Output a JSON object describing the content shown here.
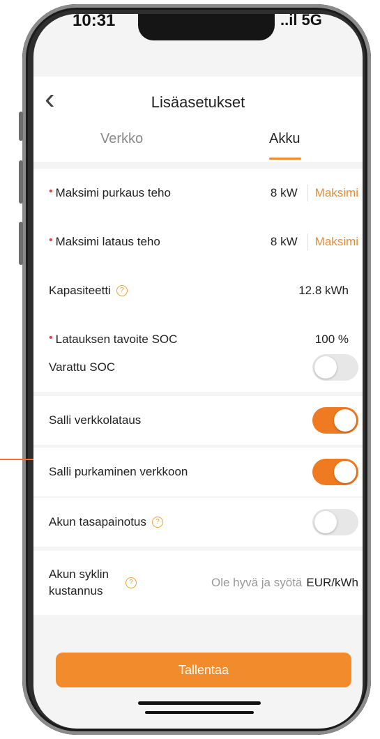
{
  "status_bar": {
    "time": "10:31",
    "right": "..il 5G"
  },
  "nav": {
    "back_icon": "chevron-left-icon",
    "title": "Lisäasetukset"
  },
  "tabs": [
    {
      "label": "Verkko"
    },
    {
      "label": "Akku"
    }
  ],
  "settings": {
    "max_discharge": {
      "required": "•",
      "label": "Maksimi purkaus teho",
      "value": "8 kW",
      "action": "Maksimi"
    },
    "max_charge": {
      "required": "•",
      "label": "Maksimi lataus teho",
      "value": "8 kW",
      "action": "Maksimi"
    },
    "capacity": {
      "label": "Kapasiteetti",
      "value": "12.8 kWh",
      "help": "?"
    },
    "target_soc": {
      "required": "•",
      "label": "Latauksen tavoite SOC",
      "value": "100 %"
    },
    "reserved_soc": {
      "label": "Varattu SOC",
      "enabled": false
    },
    "grid_charging": {
      "label": "Salli verkkolataus",
      "enabled": true
    },
    "grid_discharge": {
      "label": "Salli purkaminen verkkoon",
      "enabled": true
    },
    "balancing": {
      "label": "Akun tasapainotus",
      "enabled": false,
      "help": "?"
    },
    "cycle_cost": {
      "label_line1": "Akun syklin",
      "label_line2": "kustannus",
      "placeholder": "Ole hyvä ja syötä",
      "unit": "EUR/kWh",
      "help": "?"
    }
  },
  "save_button": "Tallentaa",
  "colors": {
    "accent": "#f07a22",
    "required": "#e0484f"
  }
}
